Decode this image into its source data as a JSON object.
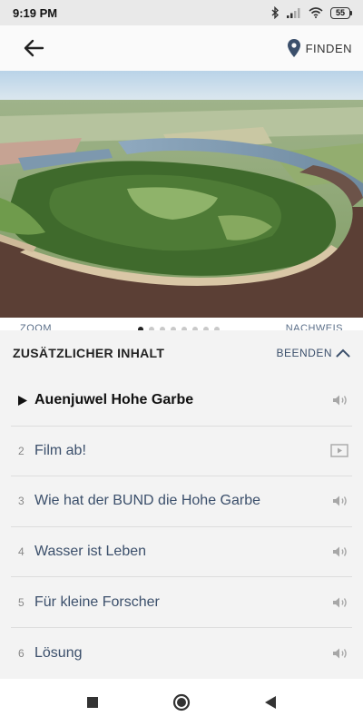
{
  "status_bar": {
    "time": "9:19 PM",
    "battery": "55"
  },
  "header": {
    "find_label": "FINDEN"
  },
  "image_strip": {
    "zoom_label": "ZOOM",
    "credit_label": "NACHWEIS",
    "dots_total": 8,
    "dots_active": 1
  },
  "panel": {
    "title": "ZUSÄTZLICHER INHALT",
    "end_label": "BEENDEN",
    "items": [
      {
        "num": "",
        "label": "Auenjuwel Hohe Garbe",
        "icon": "speaker-icon",
        "active": true
      },
      {
        "num": "2",
        "label": "Film ab!",
        "icon": "video-icon",
        "active": false
      },
      {
        "num": "3",
        "label": "Wie hat der BUND die Hohe Garbe",
        "icon": "speaker-icon",
        "active": false
      },
      {
        "num": "4",
        "label": "Wasser ist Leben",
        "icon": "speaker-icon",
        "active": false
      },
      {
        "num": "5",
        "label": "Für kleine Forscher",
        "icon": "speaker-icon",
        "active": false
      },
      {
        "num": "6",
        "label": "Lösung",
        "icon": "speaker-icon",
        "active": false
      }
    ]
  },
  "colors": {
    "accent": "#3b4f6b",
    "status_bar_bg": "#e9e9e9",
    "panel_bg": "#f3f3f3"
  }
}
